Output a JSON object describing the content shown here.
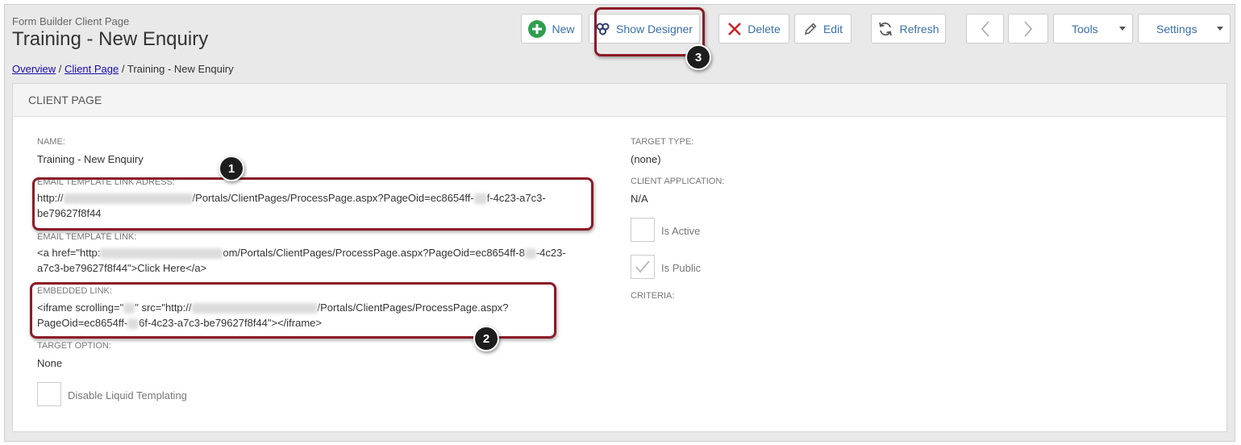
{
  "header": {
    "subtitle": "Form Builder Client Page",
    "title": "Training - New Enquiry"
  },
  "breadcrumb": {
    "items": [
      "Overview",
      "Client Page"
    ],
    "sep": " / ",
    "current": "Training - New Enquiry"
  },
  "toolbar": {
    "new_label": "New",
    "designer_label": "Show Designer",
    "delete_label": "Delete",
    "edit_label": "Edit",
    "refresh_label": "Refresh",
    "tools_label": "Tools",
    "settings_label": "Settings"
  },
  "panel": {
    "header": "CLIENT PAGE",
    "name_label": "NAME:",
    "name_value": "Training - New Enquiry",
    "email_link_address_label": "EMAIL TEMPLATE LINK ADRESS:",
    "email_link_address_l1_a": "http://",
    "email_link_address_l1_b": "/Portals/ClientPages/ProcessPage.aspx?PageOid=ec8654ff-",
    "email_link_address_l1_c": "f-4c23-a7c3-",
    "email_link_address_l2": "be79627f8f44",
    "email_link_label": "EMAIL TEMPLATE LINK:",
    "email_link_l1_a": "<a href=\"http:",
    "email_link_l1_b": "om/Portals/ClientPages/ProcessPage.aspx?PageOid=ec8654ff-8",
    "email_link_l1_c": "-4c23-",
    "email_link_l2": "a7c3-be79627f8f44\">Click Here</a>",
    "embedded_label": "EMBEDDED LINK:",
    "embedded_l1_a": "<iframe scrolling=\"",
    "embedded_l1_b": "\" src=\"http://",
    "embedded_l1_c": "/Portals/ClientPages/ProcessPage.aspx?",
    "embedded_l2_a": "PageOid=ec8654ff-",
    "embedded_l2_b": "6f-4c23-a7c3-be79627f8f44\"></iframe>",
    "target_option_label": "TARGET OPTION:",
    "target_option_value": "None",
    "disable_liquid_label": "Disable Liquid Templating",
    "target_type_label": "TARGET TYPE:",
    "target_type_value": "(none)",
    "client_app_label": "CLIENT APPLICATION:",
    "client_app_value": "N/A",
    "is_active_label": "Is Active",
    "is_public_label": "Is Public",
    "criteria_label": "CRITERIA:"
  },
  "annotations": [
    "1",
    "2",
    "3"
  ],
  "colors": {
    "callout": "#8b1c26",
    "link": "#3a6fa8",
    "new_icon": "#2e9e4f",
    "delete_icon": "#c8232c"
  }
}
